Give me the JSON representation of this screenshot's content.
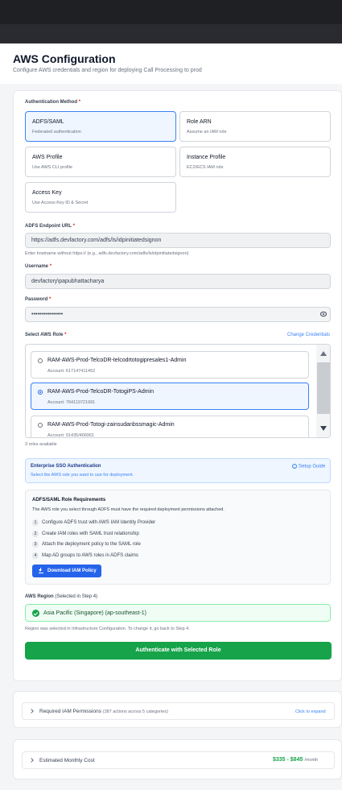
{
  "header": {
    "title": "AWS Configuration",
    "subtitle": "Configure AWS credentials and region for deploying Call Processing to prod"
  },
  "auth": {
    "label": "Authentication Method",
    "required": "*",
    "options": [
      {
        "title": "ADFS/SAML",
        "desc": "Federated authentication",
        "selected": true
      },
      {
        "title": "Role ARN",
        "desc": "Assume an IAM role",
        "selected": false
      },
      {
        "title": "AWS Profile",
        "desc": "Use AWS CLI profile",
        "selected": false
      },
      {
        "title": "Instance Profile",
        "desc": "EC2/ECS IAM role",
        "selected": false
      },
      {
        "title": "Access Key",
        "desc": "Use Access Key ID & Secret",
        "selected": false
      }
    ]
  },
  "endpoint": {
    "label": "ADFS Endpoint URL",
    "value": "https://adfs.devfactory.com/adfs/ls/idpinitiatedsignon",
    "hint": "Enter hostname without https:// (e.g., adfs.devfactory.com/adfs/ls/idpinitiatedsignon)"
  },
  "username": {
    "label": "Username",
    "value": "devfactory\\papubhattacharya"
  },
  "password": {
    "label": "Password",
    "value": "••••••••••••••••"
  },
  "role": {
    "label": "Select AWS Role",
    "change_link": "Change Credentials",
    "items": [
      {
        "name": "RAM-AWS-Prod-TelcoDR-telcodrtotogipresales1-Admin",
        "account": "Account: 617147411452",
        "selected": false
      },
      {
        "name": "RAM-AWS-Prod-TelcoDR-TotogiPS-Admin",
        "account": "Account: 764119721991",
        "selected": true
      },
      {
        "name": "RAM-AWS-Prod-Totogi-zainsudanbssmagic-Admin",
        "account": "Account: 91435/406961",
        "selected": false
      }
    ],
    "count": "3 roles available"
  },
  "sso": {
    "title": "Enterprise SSO Authentication",
    "desc": "Select the AWS role you want to use for deployment.",
    "setup_link": "Setup Guide"
  },
  "requirements": {
    "title": "ADFS/SAML Role Requirements",
    "desc": "The AWS role you select through ADFS must have the required deployment permissions attached.",
    "steps": [
      "Configure ADFS trust with AWS IAM Identity Provider",
      "Create IAM roles with SAML trust relationship",
      "Attach the deployment policy to the SAML role",
      "Map AD groups to AWS roles in ADFS claims"
    ],
    "download": "Download IAM Policy"
  },
  "region": {
    "label": "AWS Region",
    "label_note": "(Selected in Step 4)",
    "value": "Asia Pacific (Singapore) (ap-southeast-1)",
    "hint": "Region was selected in Infrastructure Configuration. To change it, go back to Step 4."
  },
  "authenticate_button": "Authenticate with Selected Role",
  "iam_panel": {
    "title": "Required IAM Permissions",
    "meta": "(387 actions across 5 categories)",
    "expand": "Click to expand"
  },
  "cost_panel": {
    "title": "Estimated Monthly Cost",
    "value": "$335 - $845",
    "unit": "/month"
  },
  "colors": {
    "accent": "#2563eb",
    "success": "#16a34a"
  }
}
